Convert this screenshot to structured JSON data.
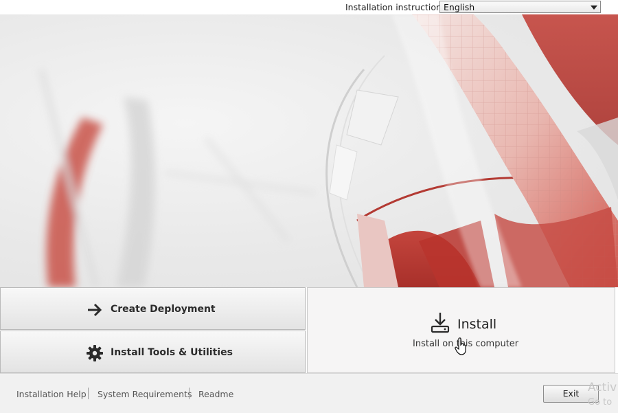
{
  "header": {
    "instructions_label": "Installation instructions:",
    "language_value": "English"
  },
  "actions": {
    "create_deployment": "Create Deployment",
    "install_tools": "Install Tools & Utilities",
    "install_title": "Install",
    "install_subtitle": "Install on this computer"
  },
  "footer": {
    "links": [
      "Installation Help",
      "System Requirements",
      "Readme"
    ],
    "exit_label": "Exit",
    "watermark_line1": "Activ",
    "watermark_line2": "Go to"
  },
  "icons": {
    "create_deployment": "arrow-right-icon",
    "install_tools": "gear-icon",
    "install": "download-icon",
    "dropdown": "chevron-down-icon",
    "pointer": "hand-pointer-icon"
  },
  "colors": {
    "accent_red": "#c9483f",
    "panel_light": "#f4f4f4",
    "footer_bg": "#f1f1f1"
  }
}
